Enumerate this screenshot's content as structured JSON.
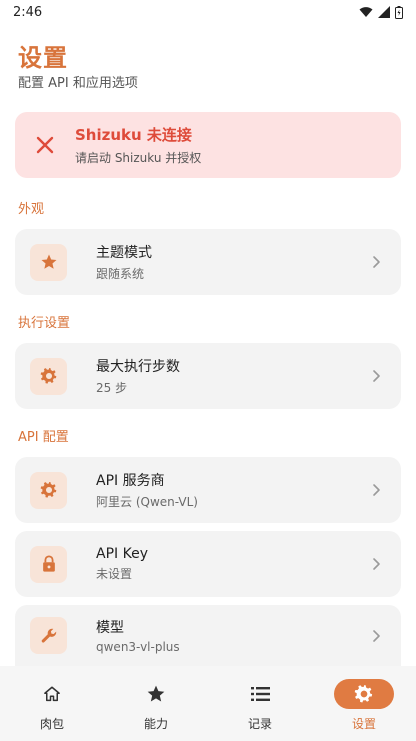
{
  "status_bar": {
    "time": "2:46"
  },
  "header": {
    "title": "设置",
    "subtitle": "配置 API 和应用选项"
  },
  "alert": {
    "title": "Shizuku 未连接",
    "description": "请启动 Shizuku 并授权",
    "icon": "close-icon",
    "color": "#de4b3a"
  },
  "sections": {
    "appearance": {
      "label": "外观",
      "items": [
        {
          "title": "主题模式",
          "subtitle": "跟随系统",
          "icon": "star-icon"
        }
      ]
    },
    "execution": {
      "label": "执行设置",
      "items": [
        {
          "title": "最大执行步数",
          "subtitle": "25 步",
          "icon": "gear-icon"
        }
      ]
    },
    "api": {
      "label": "API 配置",
      "items": [
        {
          "title": "API 服务商",
          "subtitle": "阿里云 (Qwen-VL)",
          "icon": "gear-icon"
        },
        {
          "title": "API Key",
          "subtitle": "未设置",
          "icon": "lock-icon"
        },
        {
          "title": "模型",
          "subtitle": "qwen3-vl-plus",
          "icon": "wrench-icon"
        }
      ]
    }
  },
  "bottom_nav": {
    "items": [
      {
        "label": "肉包",
        "icon": "home-icon",
        "active": false
      },
      {
        "label": "能力",
        "icon": "star-icon",
        "active": false
      },
      {
        "label": "记录",
        "icon": "list-icon",
        "active": false
      },
      {
        "label": "设置",
        "icon": "gear-icon",
        "active": true
      }
    ]
  },
  "colors": {
    "accent": "#d8743b",
    "accent_fill": "#e07b42",
    "icon_bg": "#f8e4d8",
    "card_bg": "#f3f3f3",
    "alert_bg": "#fde2e2"
  }
}
